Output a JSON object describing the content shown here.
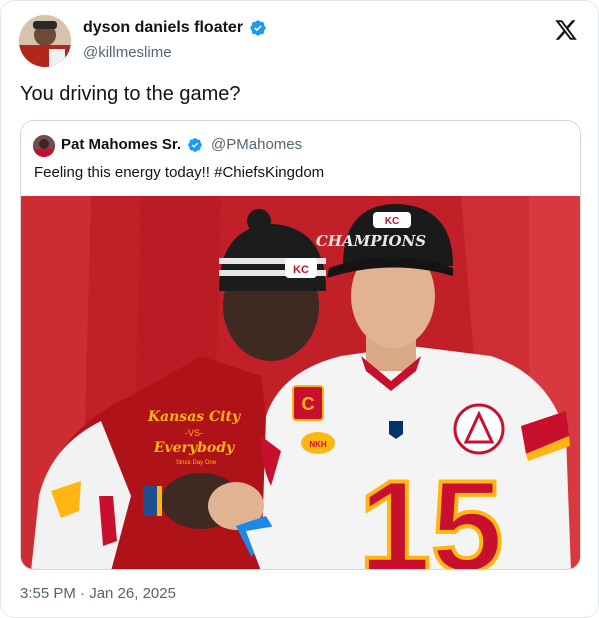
{
  "author": {
    "display_name": "dyson daniels floater",
    "handle": "@killmeslime"
  },
  "tweet": {
    "text": "You driving to the game?",
    "timestamp": "3:55 PM · Jan 26, 2025"
  },
  "quoted": {
    "display_name": "Pat Mahomes Sr.",
    "handle": "@PMahomes",
    "text": "Feeling this energy today!! #ChiefsKingdom",
    "photo": {
      "hat_text": "CHAMPIONS",
      "jacket_lines": [
        "Kansas City",
        "-VS-",
        "Everybody",
        "Since Day One"
      ],
      "jersey_number": "15",
      "jersey_letter": "C",
      "patch_text": "NKH"
    }
  },
  "colors": {
    "verified": "#1d9bf0",
    "chiefs_red": "#c8102e",
    "gold": "#ffb612",
    "text_secondary": "#536471"
  },
  "icons": {
    "logo": "x-logo-icon",
    "verified": "verified-badge-icon"
  }
}
